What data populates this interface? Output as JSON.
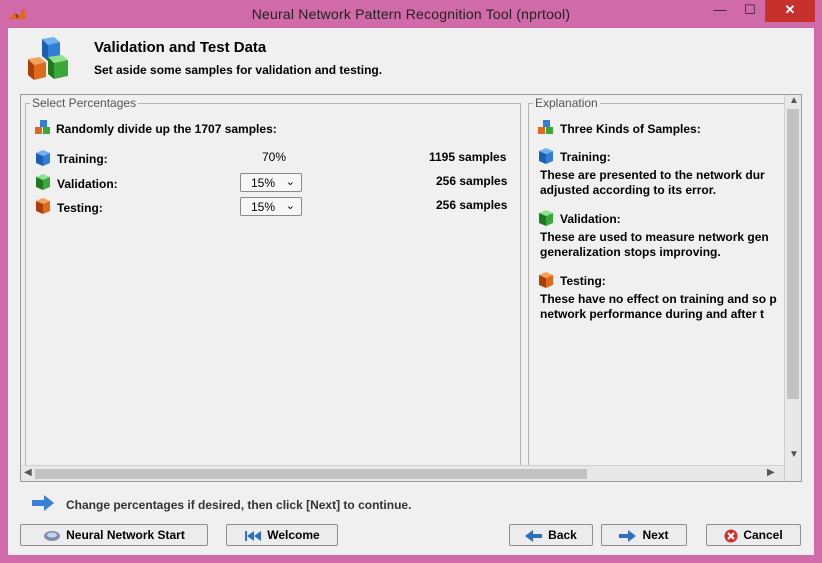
{
  "window": {
    "title": "Neural Network Pattern Recognition Tool (nprtool)",
    "minimize_glyph": "—",
    "maximize_glyph": "☐",
    "close_glyph": "✕"
  },
  "header": {
    "title": "Validation and Test Data",
    "subtitle": "Set aside some samples for validation and testing."
  },
  "left_panel": {
    "legend": "Select Percentages",
    "intro": "Randomly divide up the 1707 samples:",
    "rows": [
      {
        "label": "Training:",
        "percent": "70%",
        "samples": "1195 samples",
        "icon": "blue-cube-icon"
      },
      {
        "label": "Validation:",
        "percent": "15%",
        "samples": "256 samples",
        "icon": "green-cube-icon"
      },
      {
        "label": "Testing:",
        "percent": "15%",
        "samples": "256 samples",
        "icon": "orange-cube-icon"
      }
    ]
  },
  "right_panel": {
    "legend": "Explanation",
    "heading": "Three Kinds of Samples:",
    "sections": [
      {
        "title": "Training:",
        "line1": "These are presented to the network dur",
        "line2": "adjusted according to its error."
      },
      {
        "title": "Validation:",
        "line1": "These are used to measure network gen",
        "line2": "generalization stops improving."
      },
      {
        "title": "Testing:",
        "line1": "These have no effect on training and so p",
        "line2": "network performance during and after t"
      }
    ]
  },
  "status": {
    "text": "Change percentages if desired, then click [Next] to continue."
  },
  "buttons": {
    "nn_start": "Neural Network Start",
    "welcome": "Welcome",
    "back": "Back",
    "next": "Next",
    "cancel": "Cancel"
  },
  "colors": {
    "title_bar": "#d06aa8",
    "close_button": "#c7302c",
    "cube_blue": "#2f7fd6",
    "cube_green": "#3aa83a",
    "cube_orange": "#e06a1c"
  }
}
